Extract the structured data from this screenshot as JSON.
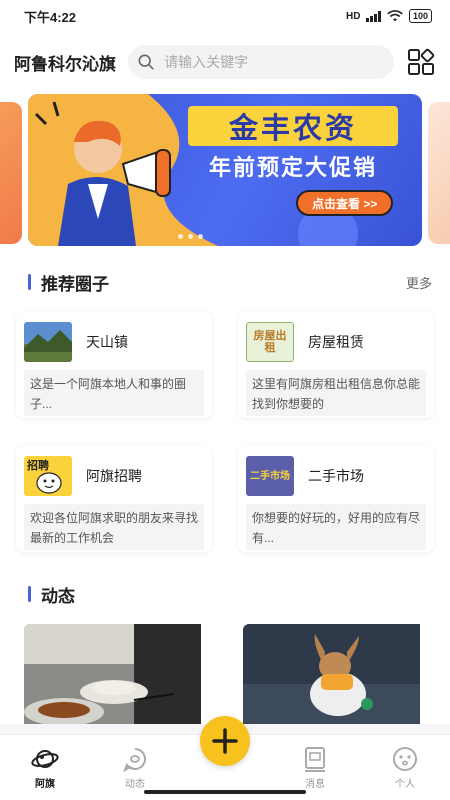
{
  "status": {
    "time": "下午4:22",
    "network": "HD",
    "battery": "100"
  },
  "header": {
    "city": "阿鲁科尔沁旗",
    "search_placeholder": "请输入关键字",
    "menu_icon": "grid-icon"
  },
  "banner": {
    "title": "金丰农资",
    "subtitle": "年前预定大促销",
    "button": "点击查看 >>",
    "colors": {
      "bg": "#4D6CF0",
      "title_bg": "#F9D23C",
      "button": "#F0702A"
    }
  },
  "circles_section": {
    "title": "推荐圈子",
    "more": "更多",
    "items": [
      {
        "name": "天山镇",
        "desc": "这是一个阿旗本地人和事的圈子...",
        "thumb": "landscape-icon"
      },
      {
        "name": "房屋租赁",
        "desc": "这里有阿旗房租出租信息你总能找到你想要的",
        "thumb": "house-rental-icon",
        "badge": "房屋出租"
      },
      {
        "name": "阿旗招聘",
        "desc": "欢迎各位阿旗求职的朋友来寻找最新的工作机会",
        "thumb": "recruit-icon",
        "badge": "招聘"
      },
      {
        "name": "二手市场",
        "desc": "你想要的好玩的，好用的应有尽有...",
        "thumb": "second-hand-icon",
        "badge": "二手市场"
      }
    ]
  },
  "feed_section": {
    "title": "动态"
  },
  "tabbar": {
    "items": [
      {
        "label": "阿旗",
        "icon": "planet-icon",
        "active": true
      },
      {
        "label": "动态",
        "icon": "chat-bubble-icon",
        "active": false
      },
      {
        "label": "消息",
        "icon": "message-box-icon",
        "active": false
      },
      {
        "label": "个人",
        "icon": "face-icon",
        "active": false
      }
    ],
    "fab_icon": "plus-icon",
    "accent": "#F7C21D"
  }
}
